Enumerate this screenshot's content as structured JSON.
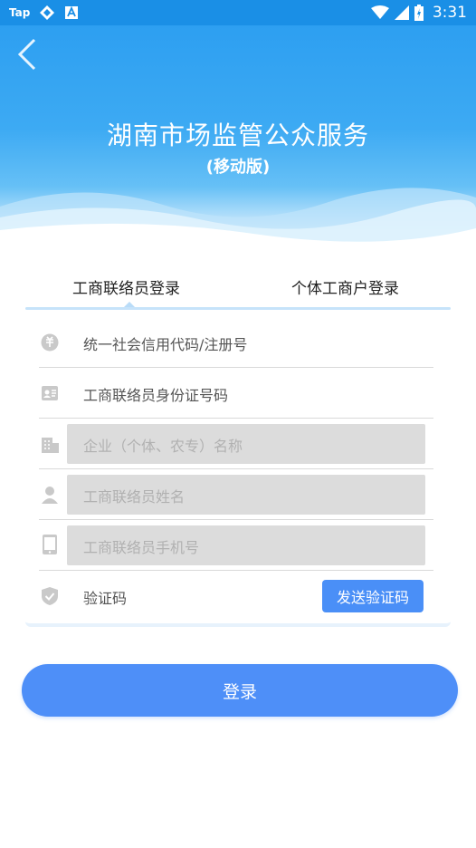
{
  "status_bar": {
    "left_label": "Tap",
    "time": "3:31"
  },
  "header": {
    "title": "湖南市场监管公众服务",
    "subtitle": "(移动版)"
  },
  "tabs": [
    {
      "label": "工商联络员登录",
      "active": true
    },
    {
      "label": "个体工商户登录",
      "active": false
    }
  ],
  "form": {
    "credit_code": {
      "placeholder": "统一社会信用代码/注册号"
    },
    "id_number": {
      "placeholder": "工商联络员身份证号码"
    },
    "company_name": {
      "placeholder": "企业（个体、农专）名称"
    },
    "liaison_name": {
      "placeholder": "工商联络员姓名"
    },
    "liaison_phone": {
      "placeholder": "工商联络员手机号"
    },
    "verification_code": {
      "placeholder": "验证码"
    },
    "send_code_label": "发送验证码"
  },
  "login_label": "登录",
  "colors": {
    "accent": "#4e8ff8",
    "hero_blue": "#2d9ff1",
    "disabled_field": "#dcdcdc"
  }
}
